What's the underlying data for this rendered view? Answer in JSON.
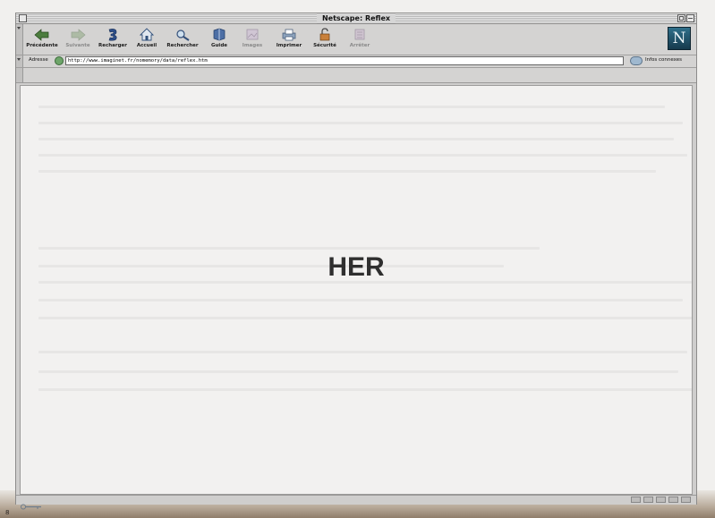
{
  "window": {
    "title": "Netscape: Reflex"
  },
  "toolbar": {
    "buttons": [
      {
        "label": "Précédente",
        "icon": "back-arrow-icon",
        "enabled": true
      },
      {
        "label": "Suivante",
        "icon": "forward-arrow-icon",
        "enabled": false
      },
      {
        "label": "Recharger",
        "icon": "reload-icon",
        "enabled": true
      },
      {
        "label": "Accueil",
        "icon": "home-icon",
        "enabled": true
      },
      {
        "label": "Rechercher",
        "icon": "search-icon",
        "enabled": true
      },
      {
        "label": "Guide",
        "icon": "guide-icon",
        "enabled": true
      },
      {
        "label": "Images",
        "icon": "images-icon",
        "enabled": false
      },
      {
        "label": "Imprimer",
        "icon": "print-icon",
        "enabled": true
      },
      {
        "label": "Sécurité",
        "icon": "security-lock-icon",
        "enabled": true
      },
      {
        "label": "Arrêter",
        "icon": "stop-icon",
        "enabled": false
      }
    ],
    "logo_letter": "N"
  },
  "location": {
    "label": "Adresse",
    "url": "http://www.imaginet.fr/nomemory/data/reflex.htm",
    "infos_label": "Infos connexes"
  },
  "content": {
    "headline": "HER"
  },
  "page_number": "8",
  "colors": {
    "chrome": "#d4d3d2",
    "content_bg": "#f2f1f0",
    "headline": "#2f2f2f",
    "logo_bg": "#1f5168"
  }
}
